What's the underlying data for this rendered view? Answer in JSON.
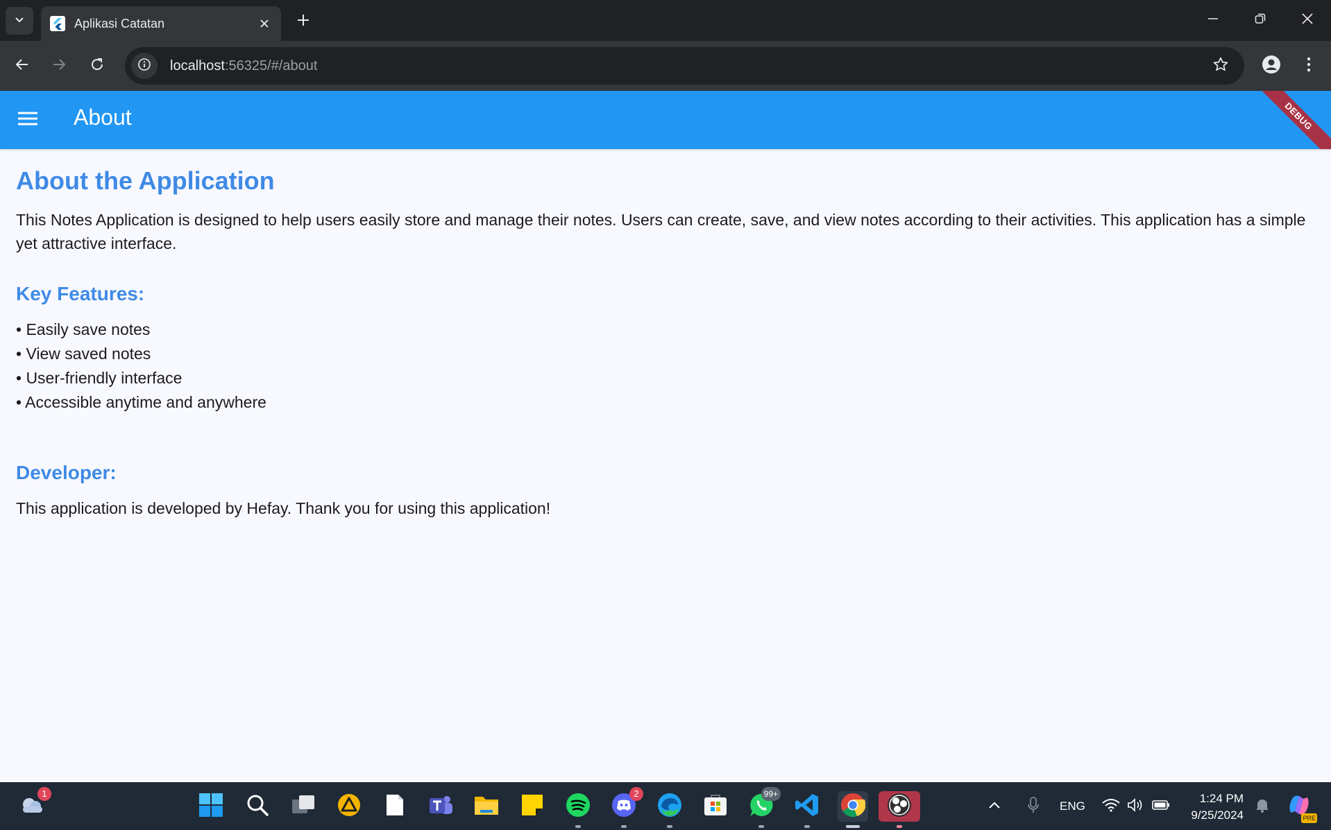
{
  "browser": {
    "tab_title": "Aplikasi Catatan",
    "url_host": "localhost",
    "url_rest": ":56325/#/about"
  },
  "app": {
    "appbar_title": "About",
    "debug_label": "DEBUG",
    "heading": "About the Application",
    "description": "This Notes Application is designed to help users easily store and manage their notes. Users can create, save, and view notes according to their activities. This application has a simple yet attractive interface.",
    "features_heading": "Key Features:",
    "features": [
      "• Easily save notes",
      "• View saved notes",
      "• User-friendly interface",
      "• Accessible anytime and anywhere"
    ],
    "developer_heading": "Developer:",
    "developer_text": "This application is developed by Hefay. Thank you for using this application!"
  },
  "taskbar": {
    "weather_badge": "1",
    "discord_badge": "2",
    "whatsapp_badge": "99+",
    "language": "ENG",
    "time": "1:24 PM",
    "date": "9/25/2024",
    "copilot_label": "PRE"
  },
  "colors": {
    "appbar": "#2196f3",
    "heading": "#3f8ae6",
    "debug": "#a83245"
  }
}
